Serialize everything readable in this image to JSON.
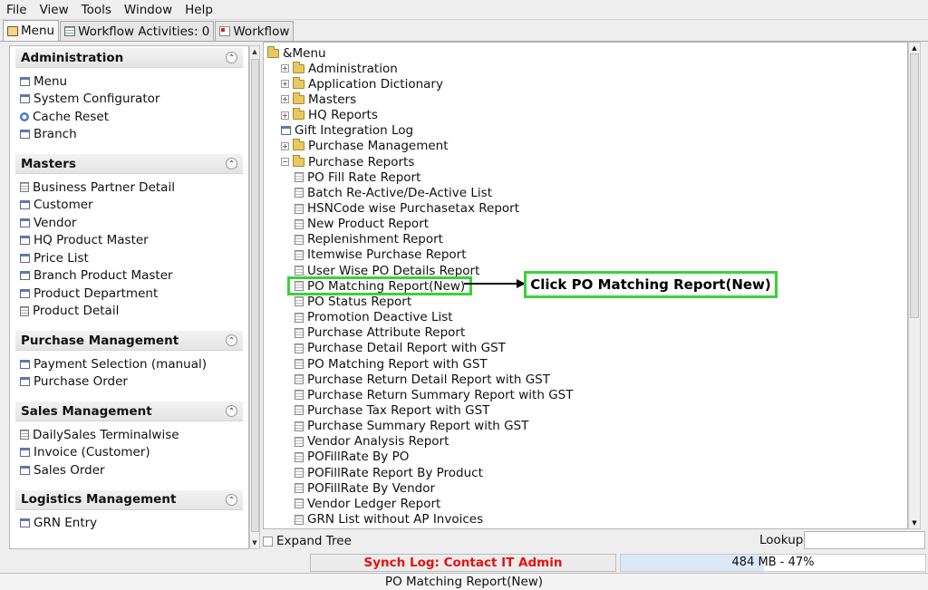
{
  "menubar": {
    "items": [
      {
        "label": "File"
      },
      {
        "label": "View"
      },
      {
        "label": "Tools"
      },
      {
        "label": "Window"
      },
      {
        "label": "Help"
      }
    ]
  },
  "tabs": [
    {
      "label": "Menu",
      "icon": "home-icon"
    },
    {
      "label": "Workflow Activities: 0",
      "icon": "document-icon"
    },
    {
      "label": "Workflow",
      "icon": "workflow-icon"
    }
  ],
  "sidebar": {
    "sections": [
      {
        "title": "Administration",
        "items": [
          {
            "label": "Menu",
            "icon": "window"
          },
          {
            "label": "System Configurator",
            "icon": "window"
          },
          {
            "label": "Cache Reset",
            "icon": "process"
          },
          {
            "label": "Branch",
            "icon": "window"
          }
        ]
      },
      {
        "title": "Masters",
        "items": [
          {
            "label": "Business Partner Detail",
            "icon": "report"
          },
          {
            "label": "Customer",
            "icon": "window"
          },
          {
            "label": "Vendor",
            "icon": "window"
          },
          {
            "label": "HQ Product Master",
            "icon": "window"
          },
          {
            "label": "Price List",
            "icon": "window"
          },
          {
            "label": "Branch Product Master",
            "icon": "window"
          },
          {
            "label": "Product Department",
            "icon": "window"
          },
          {
            "label": "Product Detail",
            "icon": "report"
          }
        ]
      },
      {
        "title": "Purchase Management",
        "items": [
          {
            "label": "Payment Selection (manual)",
            "icon": "window"
          },
          {
            "label": "Purchase Order",
            "icon": "window"
          }
        ]
      },
      {
        "title": "Sales Management",
        "items": [
          {
            "label": "DailySales Terminalwise",
            "icon": "report"
          },
          {
            "label": "Invoice (Customer)",
            "icon": "window"
          },
          {
            "label": "Sales Order",
            "icon": "window"
          }
        ]
      },
      {
        "title": "Logistics Management",
        "items": [
          {
            "label": "GRN Entry",
            "icon": "window"
          }
        ]
      }
    ]
  },
  "tree": {
    "root": "&Menu",
    "folders": [
      "Administration",
      "Application Dictionary",
      "Masters",
      "HQ Reports"
    ],
    "gift": "Gift Integration Log",
    "purchase_management": "Purchase Management",
    "purchase_reports": "Purchase Reports",
    "reports": [
      "PO Fill Rate Report",
      "Batch Re-Active/De-Active List",
      "HSNCode wise Purchasetax Report",
      "New Product Report",
      "Replenishment Report",
      "Itemwise Purchase Report",
      "User Wise PO Details Report",
      "PO Matching Report(New)",
      "PO Status Report",
      "Promotion Deactive List",
      "Purchase Attribute Report",
      "Purchase Detail Report with GST",
      "PO Matching Report with GST",
      "Purchase Return Detail Report with GST",
      "Purchase Return Summary Report with GST",
      "Purchase Tax Report with GST",
      "Purchase Summary Report with GST",
      "Vendor Analysis Report",
      "POFillRate By PO",
      "POFillRate Report By Product",
      "POFillRate By Vendor",
      "Vendor Ledger Report",
      "GRN List without AP Invoices"
    ],
    "highlighted_index": 7
  },
  "callout": {
    "text": "Click PO Matching Report(New)",
    "color": "#3bd13b"
  },
  "bottom": {
    "expand_tree": "Expand Tree",
    "lookup": "Lookup",
    "lookup_value": ""
  },
  "status": {
    "synch": "Synch Log: Contact IT Admin",
    "memory": "484 MB - 47%",
    "memory_fraction": 0.47,
    "message": "PO Matching Report(New)"
  }
}
